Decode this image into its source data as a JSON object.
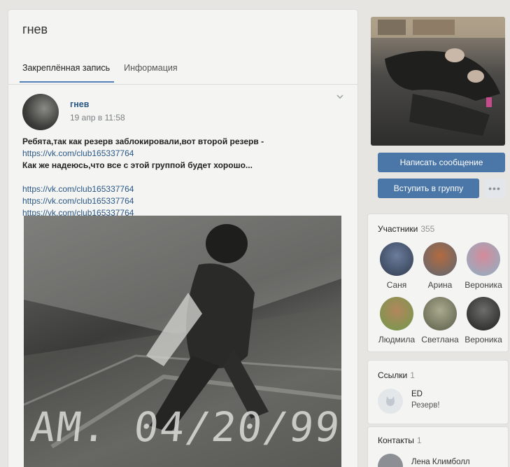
{
  "group": {
    "name": "гнев"
  },
  "tabs": [
    {
      "label": "Закреплённая запись"
    },
    {
      "label": "Информация"
    }
  ],
  "post": {
    "author": "гнев",
    "date": "19 апр в 11:58",
    "line1": "Ребята,так как резерв заблокировали,вот второй резерв -",
    "link1": "https://vk.com/club165337764",
    "line2": "Как же надеюсь,что все с этой группой будет хорошо...",
    "links": [
      "https://vk.com/club165337764",
      "https://vk.com/club165337764",
      "https://vk.com/club165337764"
    ],
    "photo_stamp": "AM. 04/20/99"
  },
  "actions": {
    "message": "Написать сообщение",
    "join": "Вступить в группу",
    "more": "•••"
  },
  "members": {
    "title": "Участники",
    "count": "355",
    "people": [
      {
        "name": "Саня",
        "color": "#4c5e7a"
      },
      {
        "name": "Арина",
        "color": "#6e7d8c"
      },
      {
        "name": "Вероника",
        "color": "#b8848e"
      },
      {
        "name": "Людмила",
        "color": "#a06a4c"
      },
      {
        "name": "Светлана",
        "color": "#7a7e6a"
      },
      {
        "name": "Вероника",
        "color": "#3f3f3d"
      }
    ]
  },
  "links_block": {
    "title": "Ссылки",
    "count": "1",
    "item_title": "ED",
    "item_sub": "Резерв!"
  },
  "contacts": {
    "title": "Контакты",
    "count": "1",
    "name": "Лена Климболл"
  }
}
